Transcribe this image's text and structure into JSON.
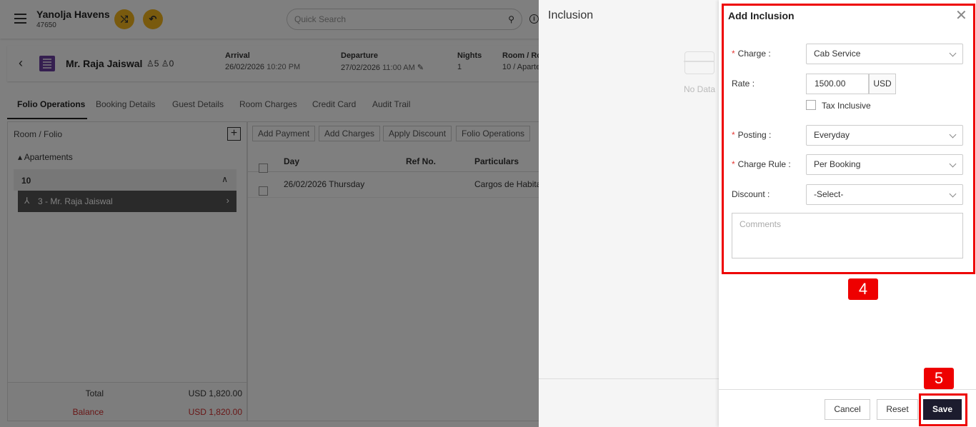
{
  "header": {
    "property_name": "Yanolja Havens",
    "property_code": "47650",
    "search_placeholder": "Quick Search"
  },
  "booking": {
    "guest_name": "Mr. Raja Jaiswal",
    "adults": "5",
    "children": "0",
    "arrival_label": "Arrival",
    "arrival_date": "26/02/2026",
    "arrival_time": "10:20 PM",
    "departure_label": "Departure",
    "departure_date": "27/02/2026",
    "departure_time": "11:00 AM",
    "nights_label": "Nights",
    "nights": "1",
    "room_label": "Room / Ro",
    "room_value": "10 / Aparte"
  },
  "tabs": [
    {
      "label": "Folio Operations"
    },
    {
      "label": "Booking Details"
    },
    {
      "label": "Guest Details"
    },
    {
      "label": "Room Charges"
    },
    {
      "label": "Credit Card"
    },
    {
      "label": "Audit Trail"
    }
  ],
  "folio": {
    "header": "Room / Folio",
    "group": "Apartements",
    "room": "10",
    "guest": "3 - Mr. Raja Jaiswal",
    "total_label": "Total",
    "total_value": "USD 1,820.00",
    "balance_label": "Balance",
    "balance_value": "USD 1,820.00"
  },
  "actions": {
    "add_payment": "Add Payment",
    "add_charges": "Add Charges",
    "apply_discount": "Apply Discount",
    "folio_operations": "Folio Operations"
  },
  "table": {
    "columns": [
      "Day",
      "Ref No.",
      "Particulars"
    ],
    "rows": [
      {
        "day": "26/02/2026 Thursday",
        "ref": "",
        "particulars": "Cargos de Habita"
      }
    ]
  },
  "inclusion": {
    "title": "Inclusion",
    "empty_text": "No Data"
  },
  "add_inclusion": {
    "title": "Add Inclusion",
    "charge_label": "Charge",
    "charge_value": "Cab Service",
    "rate_label": "Rate",
    "rate_value": "1500.00",
    "currency": "USD",
    "tax_inclusive_label": "Tax Inclusive",
    "posting_label": "Posting",
    "posting_value": "Everyday",
    "charge_rule_label": "Charge Rule",
    "charge_rule_value": "Per Booking",
    "discount_label": "Discount",
    "discount_value": "-Select-",
    "comments_placeholder": "Comments",
    "cancel": "Cancel",
    "reset": "Reset",
    "save": "Save"
  },
  "annotations": {
    "step4": "4",
    "step5": "5",
    "highlight_color": "#e00000"
  },
  "colors": {
    "accent_round_buttons": "#f3b51c",
    "save_button": "#1c1c2e",
    "required_star": "#e53935",
    "balance_red": "#d32f2f"
  }
}
